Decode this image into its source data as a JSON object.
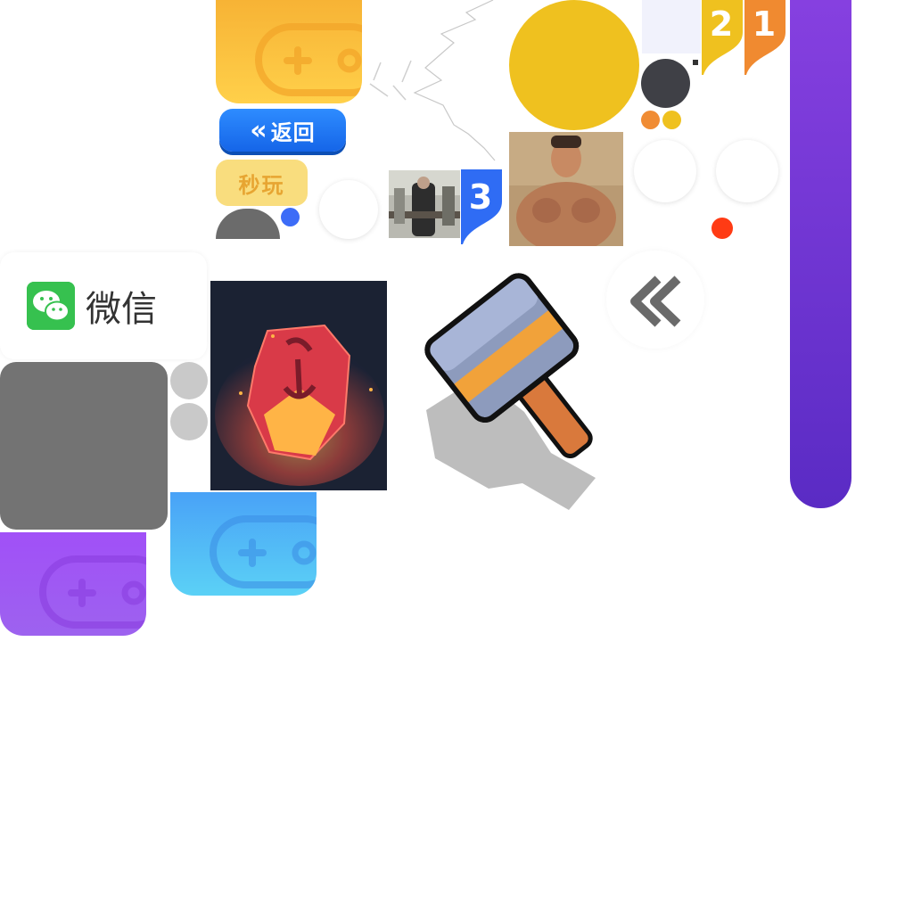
{
  "buttons": {
    "back_label": "返回",
    "instant_play_label": "秒玩"
  },
  "share": {
    "wechat_label": "微信"
  },
  "rank_badges": [
    {
      "number": "2",
      "color": "#f0c020"
    },
    {
      "number": "1",
      "color": "#f08a30"
    },
    {
      "number": "3",
      "color": "#2f6cf4"
    }
  ],
  "icons": {
    "gamepad_tiles": [
      "yellow",
      "blue",
      "purple"
    ],
    "items": [
      "gem-stone-icon",
      "hammer-icon",
      "double-chevron-left-icon",
      "wechat-icon"
    ]
  },
  "colors": {
    "yellow_tile": "#f7b731",
    "blue_tile": "#4aa6f5",
    "purple_tile": "#9856f0",
    "accent_purple": "#6e35d4",
    "badge_yellow": "#efc11f",
    "dark_circle": "#3f4046",
    "orange_dot": "#f08c34",
    "red_dot": "#ff3b14",
    "blue_dot": "#3d6cf7",
    "gray": "#737373"
  }
}
